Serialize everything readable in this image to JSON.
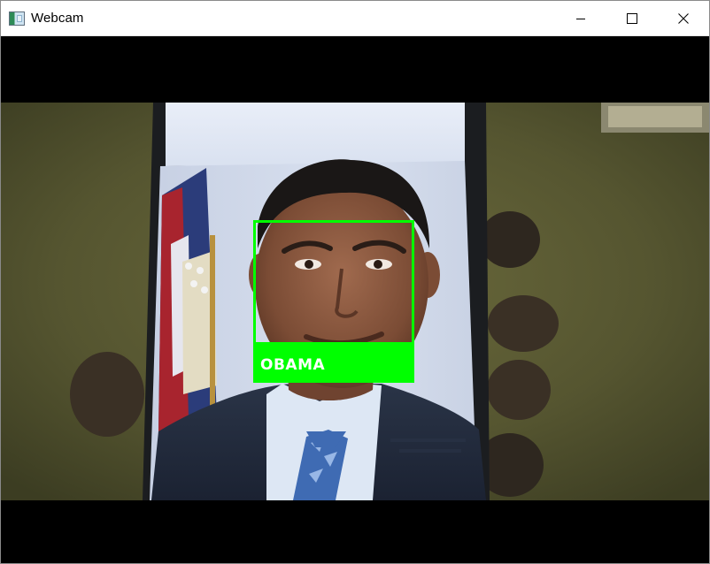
{
  "window": {
    "title": "Webcam",
    "app_icon": "webcam-app-icon",
    "controls": {
      "minimize_icon": "minimize-icon",
      "maximize_icon": "maximize-icon",
      "close_icon": "close-icon"
    }
  },
  "detection": {
    "label": "OBAMA",
    "box_color": "#00ff00",
    "label_color": "#ffffff"
  },
  "colors": {
    "letterbox": "#000000",
    "titlebar": "#ffffff"
  }
}
